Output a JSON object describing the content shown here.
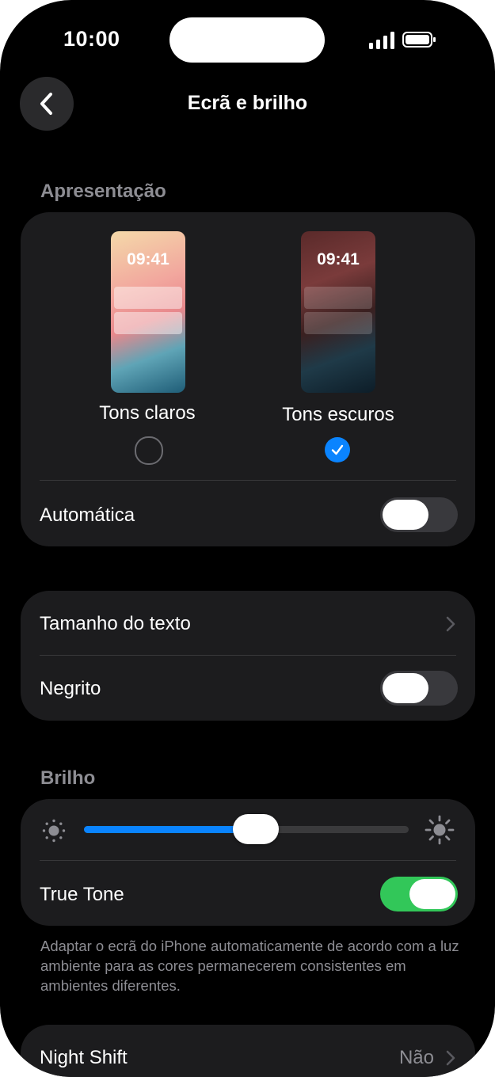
{
  "status_bar": {
    "time": "10:00"
  },
  "nav": {
    "back_icon": "chevron-left-icon",
    "title": "Ecrã e brilho"
  },
  "appearance": {
    "header": "Apresentação",
    "options": [
      {
        "preview_time": "09:41",
        "label": "Tons claros",
        "selected": false
      },
      {
        "preview_time": "09:41",
        "label": "Tons escuros",
        "selected": true
      }
    ],
    "automatic_label": "Automática",
    "automatic_on": false
  },
  "text": {
    "size_label": "Tamanho do texto",
    "bold_label": "Negrito",
    "bold_on": false
  },
  "brightness": {
    "header": "Brilho",
    "level": 0.53,
    "low_icon": "sun-low-icon",
    "high_icon": "sun-high-icon",
    "true_tone_label": "True Tone",
    "true_tone_on": true,
    "footnote": "Adaptar o ecrã do iPhone automaticamente de acordo com a luz ambiente para as cores permanecerem consistentes em ambientes diferentes."
  },
  "night_shift": {
    "label": "Night Shift",
    "value": "Não"
  },
  "colors": {
    "accent": "#0a84ff",
    "toggle_on": "#32c759",
    "card": "#1c1c1e"
  }
}
